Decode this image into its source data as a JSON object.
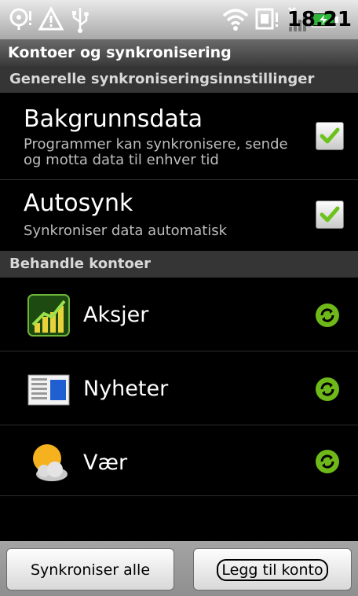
{
  "status_bar": {
    "time": "18.21",
    "icons": [
      "location-alert-icon",
      "warning-icon",
      "usb-icon",
      "wifi-icon",
      "sim-alert-icon",
      "no-signal-icon",
      "battery-charging-icon"
    ]
  },
  "title_bar": {
    "title": "Kontoer og synkronisering"
  },
  "general_section": {
    "header": "Generelle synkroniseringsinnstillinger",
    "items": [
      {
        "title": "Bakgrunnsdata",
        "summary_line1": "Programmer kan synkronisere, sende",
        "summary_line2": "og motta data til enhver tid",
        "checked": true
      },
      {
        "title": "Autosynk",
        "summary_line1": "Synkroniser data automatisk",
        "checked": true
      }
    ]
  },
  "accounts_section": {
    "header": "Behandle kontoer",
    "accounts": [
      {
        "name": "Aksjer",
        "icon": "stocks-icon"
      },
      {
        "name": "Nyheter",
        "icon": "news-icon"
      },
      {
        "name": "Vær",
        "icon": "weather-icon"
      }
    ]
  },
  "bottom_bar": {
    "sync_all_label": "Synkroniser alle",
    "add_account_label": "Legg til konto"
  },
  "colors": {
    "check_green": "#6cc21c",
    "sync_green": "#7ac11a",
    "header_bg": "#353535"
  }
}
